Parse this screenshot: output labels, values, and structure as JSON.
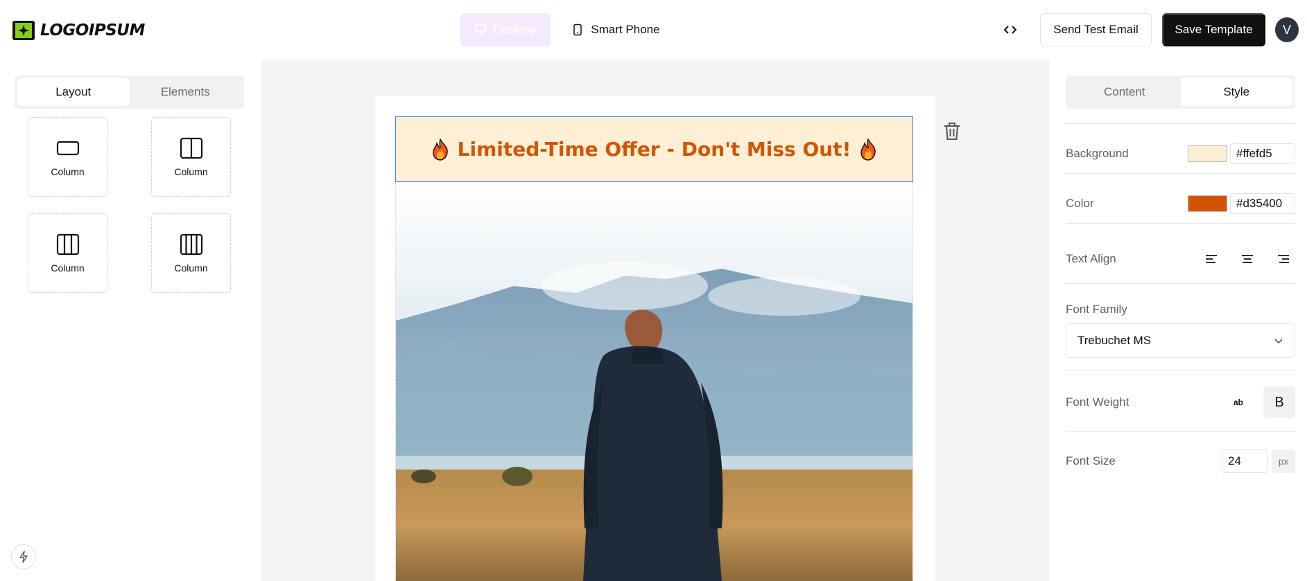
{
  "header": {
    "logo_text": "LOGOIPSUM",
    "device_desktop_label": "Desktop",
    "device_phone_label": "Smart Phone",
    "code_icon": "code-icon",
    "send_test_label": "Send Test Email",
    "save_label": "Save Template",
    "avatar_initial": "V"
  },
  "left_panel": {
    "tabs": [
      {
        "label": "Layout",
        "active": true
      },
      {
        "label": "Elements",
        "active": false
      }
    ],
    "layouts": [
      {
        "label": "Column",
        "columns": 1
      },
      {
        "label": "Column",
        "columns": 2
      },
      {
        "label": "Column",
        "columns": 3
      },
      {
        "label": "Column",
        "columns": 4
      }
    ]
  },
  "canvas": {
    "banner_text": "Limited-Time Offer - Don't Miss Out!",
    "banner_emoji": "fire-icon"
  },
  "right_panel": {
    "tabs": [
      {
        "label": "Content",
        "active": false
      },
      {
        "label": "Style",
        "active": true
      }
    ],
    "background_label": "Background",
    "background_value": "#ffefd5",
    "color_label": "Color",
    "color_value": "#d35400",
    "text_align_label": "Text Align",
    "font_family_label": "Font Family",
    "font_family_value": "Trebuchet MS",
    "font_weight_label": "Font Weight",
    "font_weight_normal": "ab",
    "font_weight_bold": "B",
    "font_size_label": "Font Size",
    "font_size_value": "24",
    "font_size_unit": "px"
  },
  "colors": {
    "banner_bg": "#ffefd5",
    "banner_text": "#d35400",
    "selection_border": "#3b82f6",
    "desktop_active_bg": "#f5e9fd"
  }
}
